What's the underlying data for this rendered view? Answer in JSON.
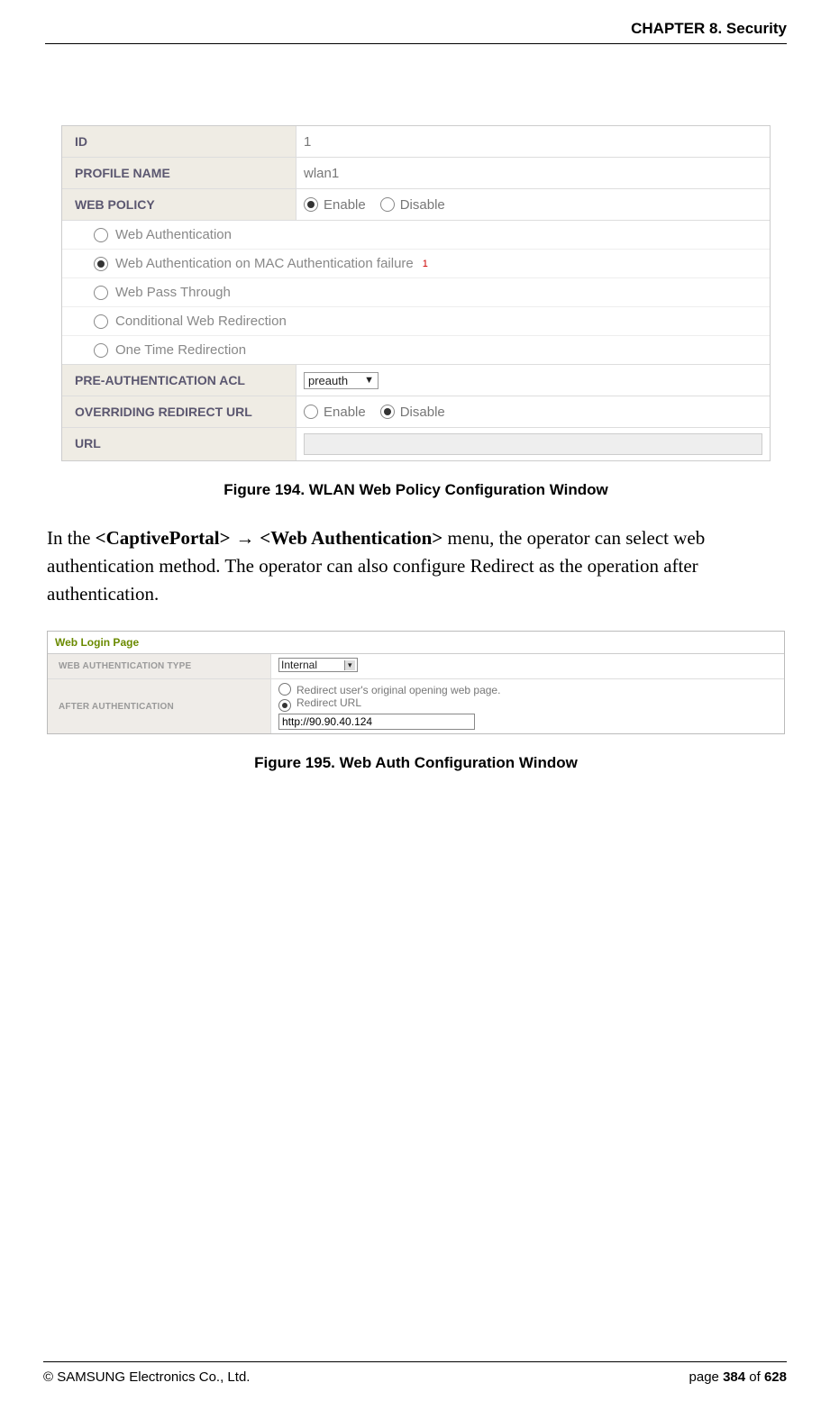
{
  "header": {
    "chapter": "CHAPTER 8. Security"
  },
  "fig194": {
    "rows": {
      "id": {
        "label": "ID",
        "value": "1"
      },
      "profile_name": {
        "label": "PROFILE NAME",
        "value": "wlan1"
      },
      "web_policy": {
        "label": "WEB POLICY",
        "enable": "Enable",
        "disable": "Disable"
      },
      "preauth_acl": {
        "label": "PRE-AUTHENTICATION ACL",
        "select_value": "preauth"
      },
      "redirect_url": {
        "label": "OVERRIDING REDIRECT URL",
        "enable": "Enable",
        "disable": "Disable"
      },
      "url": {
        "label": "URL"
      }
    },
    "policy_options": {
      "o1": "Web Authentication",
      "o2": "Web Authentication on MAC Authentication failure",
      "o2_note": "1",
      "o3": "Web Pass Through",
      "o4": "Conditional Web Redirection",
      "o5": "One Time Redirection"
    },
    "caption": "Figure 194. WLAN Web Policy Configuration Window"
  },
  "paragraph": {
    "pre": "In the ",
    "b1": "<CaptivePortal>",
    "arrow": " → ",
    "b2": "<Web Authentication>",
    "post": " menu, the operator can select web authentication method. The operator can also configure Redirect as the operation after authentication."
  },
  "fig195": {
    "title": "Web Login Page",
    "auth_type": {
      "label": "WEB AUTHENTICATION TYPE",
      "value": "Internal"
    },
    "after_auth": {
      "label": "AFTER AUTHENTICATION",
      "opt1": "Redirect user's original opening web page.",
      "opt2": "Redirect URL",
      "url": "http://90.90.40.124"
    },
    "caption": "Figure 195. Web Auth Configuration Window"
  },
  "footer": {
    "left": "© SAMSUNG Electronics Co., Ltd.",
    "right_prefix": "page ",
    "page": "384",
    "of": " of ",
    "total": "628"
  }
}
